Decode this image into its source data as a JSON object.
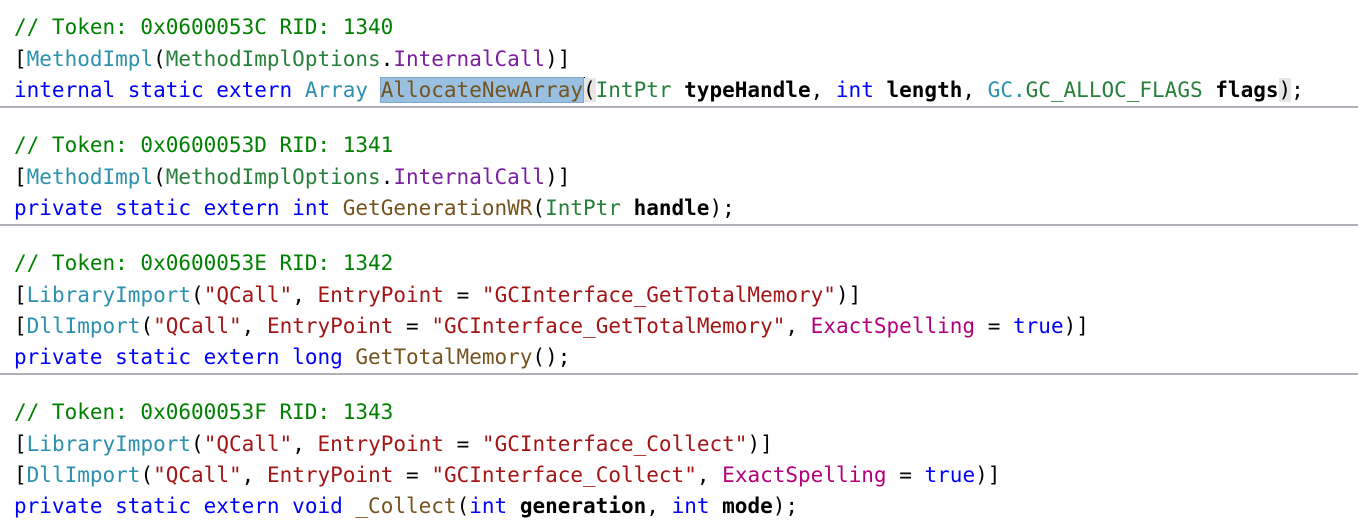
{
  "blocks": [
    {
      "comment": "// Token: 0x0600053C RID: 1340",
      "attributes": [
        {
          "open": "[",
          "name": "MethodImpl",
          "p1": "(",
          "enum_type": "MethodImplOptions",
          "dot": ".",
          "enum_member": "InternalCall",
          "close": ")]"
        }
      ],
      "signature": {
        "modifiers": "internal static extern",
        "return_type": "Array",
        "method": "AllocateNewArray",
        "open": "(",
        "p1_type": "IntPtr",
        "p1_name": "typeHandle",
        "sep1": ",",
        "p2_type": "int",
        "p2_name": "length",
        "sep2": ",",
        "p3_ns": "GC.",
        "p3_type": "GC_ALLOC_FLAGS",
        "p3_name": "flags",
        "close": ")",
        "end": ";"
      }
    },
    {
      "comment": "// Token: 0x0600053D RID: 1341",
      "attributes": [
        {
          "open": "[",
          "name": "MethodImpl",
          "p1": "(",
          "enum_type": "MethodImplOptions",
          "dot": ".",
          "enum_member": "InternalCall",
          "close": ")]"
        }
      ],
      "signature": {
        "modifiers": "private static extern",
        "return_type": "int",
        "method": "GetGenerationWR",
        "open": "(",
        "p1_type": "IntPtr",
        "p1_name": "handle",
        "close": ");"
      }
    },
    {
      "comment": "// Token: 0x0600053E RID: 1342",
      "library_import": {
        "open": "[",
        "name": "LibraryImport",
        "p1": "(",
        "lib": "\"QCall\"",
        "sep": ",",
        "prop": "EntryPoint",
        "eq": "=",
        "value": "\"GCInterface_GetTotalMemory\"",
        "close": ")]"
      },
      "dll_import": {
        "open": "[",
        "name": "DllImport",
        "p1": "(",
        "lib": "\"QCall\"",
        "sep": ",",
        "prop": "EntryPoint",
        "eq": "=",
        "value": "\"GCInterface_GetTotalMemory\"",
        "sep2": ",",
        "prop2": "ExactSpelling",
        "eq2": "=",
        "value2": "true",
        "close": ")]"
      },
      "signature": {
        "modifiers": "private static extern",
        "return_type": "long",
        "method": "GetTotalMemory",
        "close": "();"
      }
    },
    {
      "comment": "// Token: 0x0600053F RID: 1343",
      "library_import": {
        "open": "[",
        "name": "LibraryImport",
        "p1": "(",
        "lib": "\"QCall\"",
        "sep": ",",
        "prop": "EntryPoint",
        "eq": "=",
        "value": "\"GCInterface_Collect\"",
        "close": ")]"
      },
      "dll_import": {
        "open": "[",
        "name": "DllImport",
        "p1": "(",
        "lib": "\"QCall\"",
        "sep": ",",
        "prop": "EntryPoint",
        "eq": "=",
        "value": "\"GCInterface_Collect\"",
        "sep2": ",",
        "prop2": "ExactSpelling",
        "eq2": "=",
        "value2": "true",
        "close": ")]"
      },
      "signature": {
        "modifiers": "private static extern",
        "return_type": "void",
        "method": "_Collect",
        "open": "(",
        "p1_type": "int",
        "p1_name": "generation",
        "sep1": ",",
        "p2_type": "int",
        "p2_name": "mode",
        "close": ")",
        "end": ";"
      }
    }
  ],
  "colors": {
    "comment": "#008000",
    "keyword": "#0000ff",
    "type": "#2b91af",
    "string": "#a31515",
    "selection": "#99c0e0",
    "separator": "#aeb2b8"
  }
}
